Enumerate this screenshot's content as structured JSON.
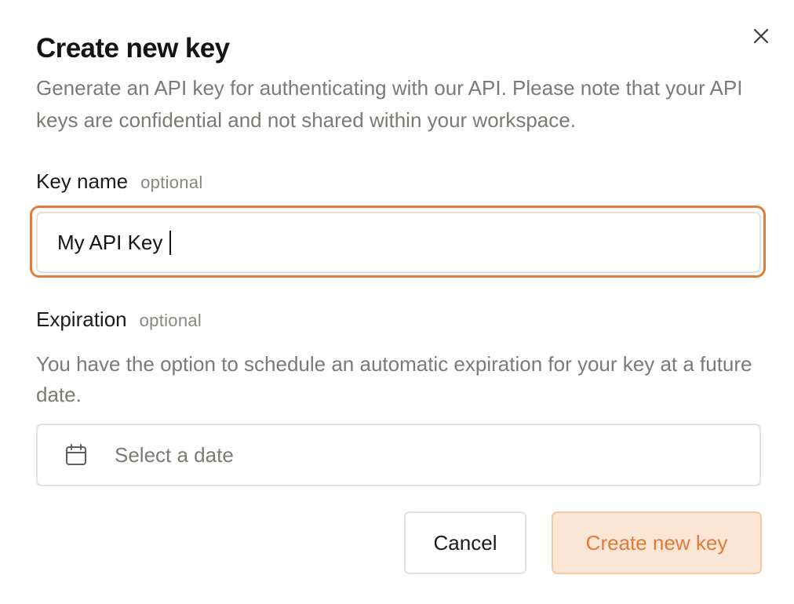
{
  "dialog": {
    "title": "Create new key",
    "description": "Generate an API key for authenticating with our API. Please note that your API keys are confidential and not shared within your workspace.",
    "close_icon": "close-icon"
  },
  "key_name": {
    "label": "Key name",
    "optional": "optional",
    "value": "My API Key"
  },
  "expiration": {
    "label": "Expiration",
    "optional": "optional",
    "description": "You have the option to schedule an automatic expiration for your key at a future date.",
    "placeholder": "Select a date",
    "icon": "calendar-icon"
  },
  "actions": {
    "cancel_label": "Cancel",
    "create_label": "Create new key"
  },
  "colors": {
    "accent": "#e07b39",
    "accent_bg": "#fbe6d6",
    "muted_text": "#7d7a75",
    "border": "#e3e1dc"
  }
}
